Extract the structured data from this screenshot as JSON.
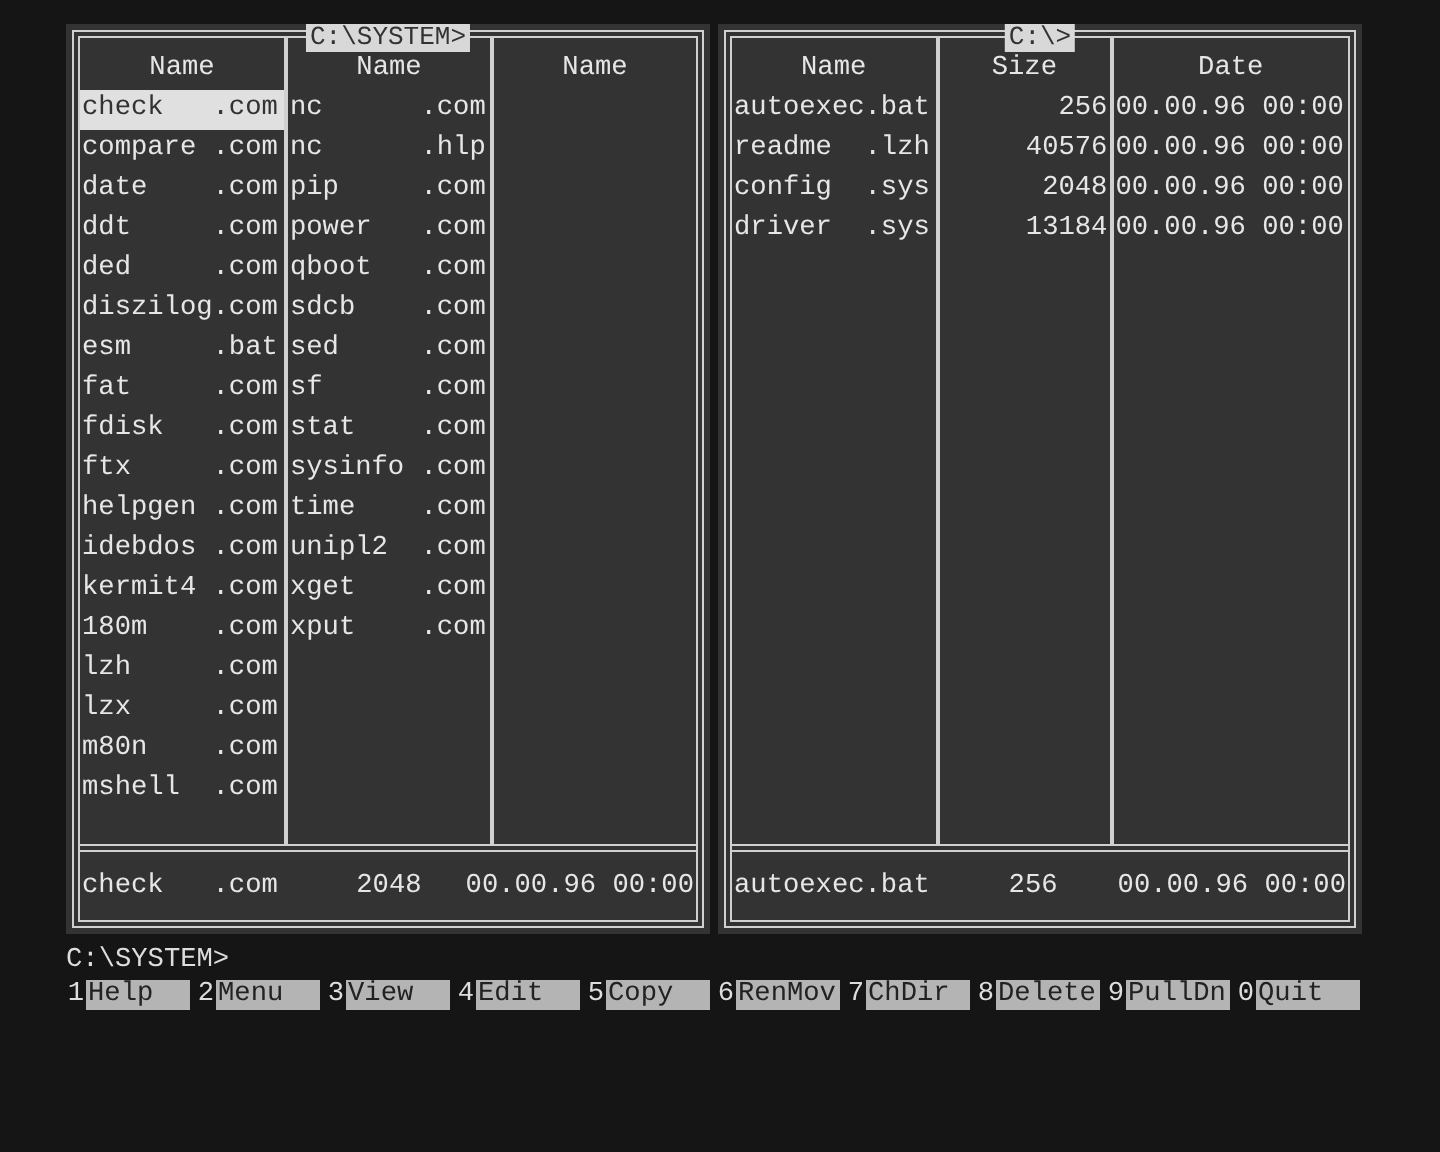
{
  "left_panel": {
    "path": "C:\\SYSTEM>",
    "columns": [
      {
        "heading": "Name",
        "files": [
          {
            "name": "check   .com",
            "selected": true
          },
          {
            "name": "compare .com",
            "selected": false
          },
          {
            "name": "date    .com",
            "selected": false
          },
          {
            "name": "ddt     .com",
            "selected": false
          },
          {
            "name": "ded     .com",
            "selected": false
          },
          {
            "name": "diszilog.com",
            "selected": false
          },
          {
            "name": "esm     .bat",
            "selected": false
          },
          {
            "name": "fat     .com",
            "selected": false
          },
          {
            "name": "fdisk   .com",
            "selected": false
          },
          {
            "name": "ftx     .com",
            "selected": false
          },
          {
            "name": "helpgen .com",
            "selected": false
          },
          {
            "name": "idebdos .com",
            "selected": false
          },
          {
            "name": "kermit4 .com",
            "selected": false
          },
          {
            "name": "180m    .com",
            "selected": false
          },
          {
            "name": "lzh     .com",
            "selected": false
          },
          {
            "name": "lzx     .com",
            "selected": false
          },
          {
            "name": "m80n    .com",
            "selected": false
          },
          {
            "name": "mshell  .com",
            "selected": false
          }
        ]
      },
      {
        "heading": "Name",
        "files": [
          {
            "name": "nc      .com",
            "selected": false
          },
          {
            "name": "nc      .hlp",
            "selected": false
          },
          {
            "name": "pip     .com",
            "selected": false
          },
          {
            "name": "power   .com",
            "selected": false
          },
          {
            "name": "qboot   .com",
            "selected": false
          },
          {
            "name": "sdcb    .com",
            "selected": false
          },
          {
            "name": "sed     .com",
            "selected": false
          },
          {
            "name": "sf      .com",
            "selected": false
          },
          {
            "name": "stat    .com",
            "selected": false
          },
          {
            "name": "sysinfo .com",
            "selected": false
          },
          {
            "name": "time    .com",
            "selected": false
          },
          {
            "name": "unipl2  .com",
            "selected": false
          },
          {
            "name": "xget    .com",
            "selected": false
          },
          {
            "name": "xput    .com",
            "selected": false
          }
        ]
      },
      {
        "heading": "Name"
      }
    ],
    "info": {
      "name": "check   .com",
      "size": "2048",
      "date": "00.00.96 00:00"
    }
  },
  "right_panel": {
    "path": "C:\\>",
    "headings": [
      "Name",
      "Size",
      "Date"
    ],
    "rows": [
      {
        "name": "autoexec.bat",
        "size": "256",
        "date": "00.00.96 00:00",
        "selected": false
      },
      {
        "name": "readme  .lzh",
        "size": "40576",
        "date": "00.00.96 00:00",
        "selected": false
      },
      {
        "name": "config  .sys",
        "size": "2048",
        "date": "00.00.96 00:00",
        "selected": false
      },
      {
        "name": "driver  .sys",
        "size": "13184",
        "date": "00.00.96 00:00",
        "selected": false
      }
    ],
    "info": {
      "name": "autoexec.bat",
      "size": "256",
      "date": "00.00.96 00:00"
    }
  },
  "command_line": "C:\\SYSTEM>",
  "keybar": [
    {
      "number": "1",
      "label": "Help"
    },
    {
      "number": "2",
      "label": "Menu"
    },
    {
      "number": "3",
      "label": "View"
    },
    {
      "number": "4",
      "label": "Edit"
    },
    {
      "number": "5",
      "label": "Copy"
    },
    {
      "number": "6",
      "label": "RenMov"
    },
    {
      "number": "7",
      "label": "ChDir"
    },
    {
      "number": "8",
      "label": "Delete"
    },
    {
      "number": "9",
      "label": "PullDn"
    },
    {
      "number": "0",
      "label": "Quit"
    }
  ]
}
